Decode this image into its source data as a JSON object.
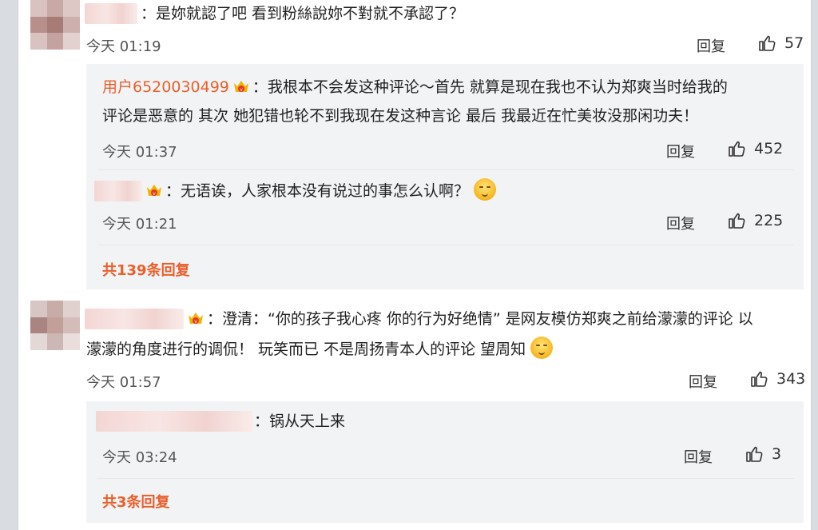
{
  "comments": [
    {
      "text": "：是妳就認了吧 看到粉絲說妳不對就不承認了？",
      "time": "今天 01:19",
      "reply_label": "回复",
      "likes": "57"
    },
    {
      "text_line1": "：澄清：“你的孩子我心疼 你的行为好绝情” 是网友模仿郑爽之前给濛濛的评论 以",
      "text_line2": "濛濛的角度进行的调侃！ 玩笑而已 不是周扬青本人的评论 望周知",
      "time": "今天 01:57",
      "reply_label": "回复",
      "likes": "343"
    }
  ],
  "subreplies": [
    {
      "username": "用户6520030499",
      "text_line1": "：我根本不会发这种评论～首先 就算是现在我也不认为郑爽当时给我的",
      "text_line2": "评论是恶意的 其次 她犯错也轮不到我现在发这种言论 最后 我最近在忙美妆没那闲功夫！",
      "time": "今天 01:37",
      "reply_label": "回复",
      "likes": "452"
    },
    {
      "text": "：无语诶，人家根本没有说过的事怎么认啊？",
      "time": "今天 01:21",
      "reply_label": "回复",
      "likes": "225"
    },
    {
      "text": "：锅从天上来",
      "time": "今天 03:24",
      "reply_label": "回复",
      "likes": "3"
    }
  ],
  "more_replies": [
    "共139条回复",
    "共3条回复"
  ],
  "colors": {
    "accent": "#e8602c",
    "panel_bg": "#f2f3f5",
    "page_bg": "#ffffff"
  },
  "icons": [
    "vip-badge-icon",
    "thumbs-up-icon",
    "emoji-icon"
  ]
}
